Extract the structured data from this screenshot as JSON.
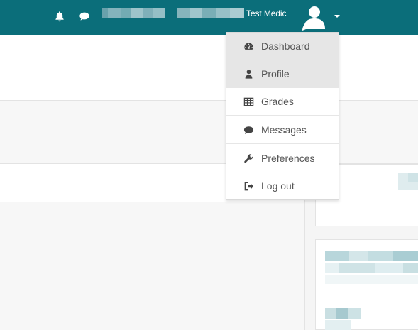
{
  "header": {
    "user_name": "Test Medic",
    "icons": {
      "notifications": "bell-icon",
      "messages": "chat-bubble-icon",
      "avatar": "user-avatar-icon",
      "menu_toggle": "caret-down-icon"
    },
    "background_color": "#0b6e7a"
  },
  "user_menu": {
    "items": [
      {
        "label": "Dashboard",
        "icon": "dashboard-icon",
        "highlighted": true
      },
      {
        "label": "Profile",
        "icon": "user-icon",
        "highlighted": true
      },
      {
        "label": "Grades",
        "icon": "table-icon",
        "highlighted": false
      },
      {
        "label": "Messages",
        "icon": "comment-icon",
        "highlighted": false
      },
      {
        "label": "Preferences",
        "icon": "wrench-icon",
        "highlighted": false
      },
      {
        "label": "Log out",
        "icon": "sign-out-icon",
        "highlighted": false
      }
    ]
  }
}
